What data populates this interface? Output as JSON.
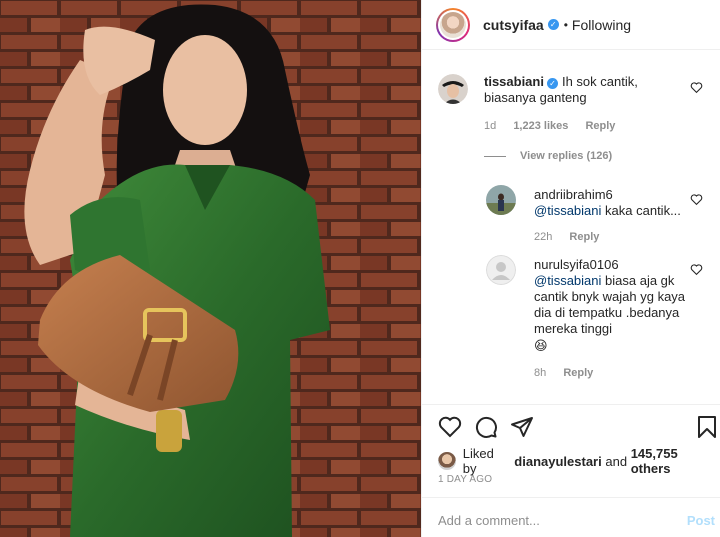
{
  "header": {
    "username": "cutsyifaa",
    "separator": "•",
    "follow_status": "Following"
  },
  "comments": [
    {
      "username": "tissabiani",
      "text": "Ih sok cantik, biasanya ganteng",
      "age": "1d",
      "likes": "1,223 likes",
      "reply_label": "Reply"
    }
  ],
  "view_replies": "View replies (126)",
  "replies": [
    {
      "username": "andriibrahim6",
      "mention": "@tissabiani",
      "text": "kaka cantik...",
      "age": "22h",
      "reply_label": "Reply"
    },
    {
      "username": "nurulsyifa0106",
      "mention": "@tissabiani",
      "text": "biasa aja gk cantik bnyk wajah yg kaya dia di tempatku .bedanya mereka tinggi",
      "emoji": "😆",
      "age": "8h",
      "reply_label": "Reply"
    }
  ],
  "likes": {
    "prefix": "Liked by",
    "user": "dianayulestari",
    "connector": "and",
    "count": "145,755 others"
  },
  "timestamp": "1 DAY AGO",
  "composer": {
    "placeholder": "Add a comment...",
    "post_label": "Post"
  },
  "colors": {
    "accent_blue": "#3897f0",
    "mention": "#00376b",
    "muted": "#8e8e8e",
    "post_disabled": "#b2dffc"
  }
}
